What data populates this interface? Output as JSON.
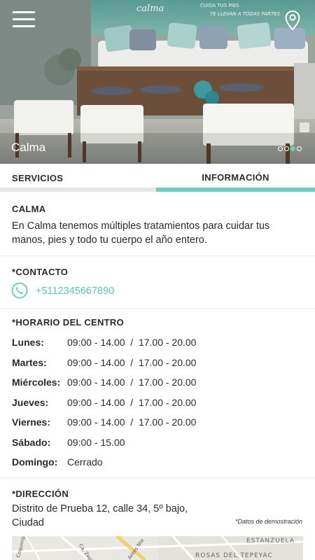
{
  "hero": {
    "title": "Calma",
    "sign_text": "calma",
    "wall_text_1": "CUIDA TUS PIES",
    "wall_text_2": "TE LLEVAN A TODAS PARTES",
    "slides_total": 4,
    "slide_active": 3
  },
  "tabs": [
    {
      "label": "SERVICIOS",
      "active": false
    },
    {
      "label": "INFORMACIÓN",
      "active": true
    }
  ],
  "about": {
    "title": "CALMA",
    "text": "En Calma tenemos múltiples tratamientos para cuidar tus manos, pies y todo tu cuerpo el año entero."
  },
  "contact": {
    "title": "*CONTACTO",
    "phone": "+5112345667890"
  },
  "schedule": {
    "title": "*HORARIO DEL CENTRO",
    "rows": [
      {
        "day": "Lunes:",
        "hours": "09:00 - 14.00  /  17.00 - 20.00"
      },
      {
        "day": "Martes:",
        "hours": "09:00 - 14.00  /  17.00 - 20.00"
      },
      {
        "day": "Miércoles:",
        "hours": "09:00 - 14.00  /  17.00 - 20.00"
      },
      {
        "day": "Jueves:",
        "hours": "09:00 - 14.00  /  17.00 - 20.00"
      },
      {
        "day": "Viernes:",
        "hours": "09:00 - 14.00  /  17.00 - 20.00"
      },
      {
        "day": "Sábado:",
        "hours": "09:00 - 15.00"
      },
      {
        "day": "Domingo:",
        "hours": "Cerrado"
      }
    ]
  },
  "address": {
    "title": "*DIRECCIÓN",
    "line1": "Distrito de Prueba 12, calle 34, 5º bajo,",
    "line2": "Ciudad",
    "demo_note": "*Datos de demostración"
  },
  "map": {
    "labels": [
      "Coquimbo",
      "Ca. Zepita",
      "ESTANZUELA",
      "ROSAS DEL TEPEYAC",
      "Antes Nte"
    ]
  },
  "colors": {
    "accent": "#6ccfbf",
    "phone_link": "#5ec4b2",
    "tab_inactive_bar": "#e6e6e6"
  }
}
